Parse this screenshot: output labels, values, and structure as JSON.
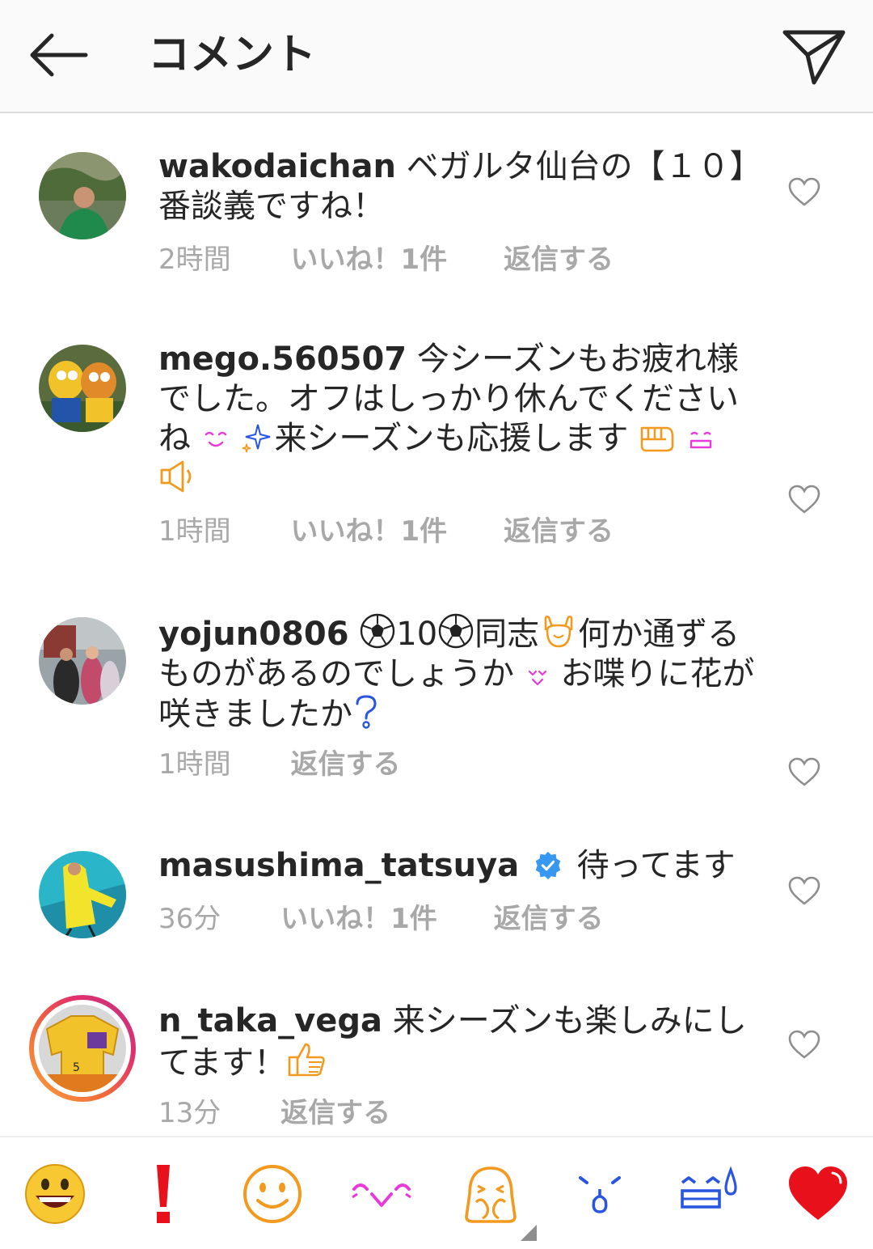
{
  "header": {
    "title": "コメント",
    "back_icon": "arrow-left-icon",
    "send_icon": "paper-plane-icon"
  },
  "comments": [
    {
      "username": "wakodaichan",
      "text": "ベガルタ仙台の【１０】番談義ですね！",
      "time": "2時間",
      "likes": "いいね！1件",
      "reply": "返信する"
    },
    {
      "username": "mego.560507",
      "text_1": "今シーズンもお疲れ様でした。オフはしっかり休んでくださいね",
      "text_2": "来シーズンも応援します",
      "time": "1時間",
      "likes": "いいね！1件",
      "reply": "返信する"
    },
    {
      "username": "yojun0806",
      "text_1": "10",
      "text_2": "同志",
      "text_3": "何か通ずるものがあるのでしょうか",
      "text_4": "お喋りに花が咲きましたか",
      "time": "1時間",
      "reply": "返信する"
    },
    {
      "username": "masushima_tatsuya",
      "verified": true,
      "text": "待ってます",
      "time": "36分",
      "likes": "いいね！1件",
      "reply": "返信する"
    },
    {
      "username": "n_taka_vega",
      "text": "来シーズンも楽しみにしてます！",
      "time": "13分",
      "reply": "返信する",
      "has_story_ring": true
    }
  ],
  "emoji_bar": {
    "items": [
      "grinning-face",
      "exclamation-mark",
      "smiley-face",
      "kaomoji-smile",
      "person-covering-face",
      "kaomoji-tears",
      "kaomoji-sweat",
      "red-heart"
    ]
  },
  "colors": {
    "accent_blue": "#3897f0",
    "meta_gray": "#a8a8a8",
    "ring_gradient": [
      "#f9a43a",
      "#e1306c",
      "#c13584"
    ]
  }
}
